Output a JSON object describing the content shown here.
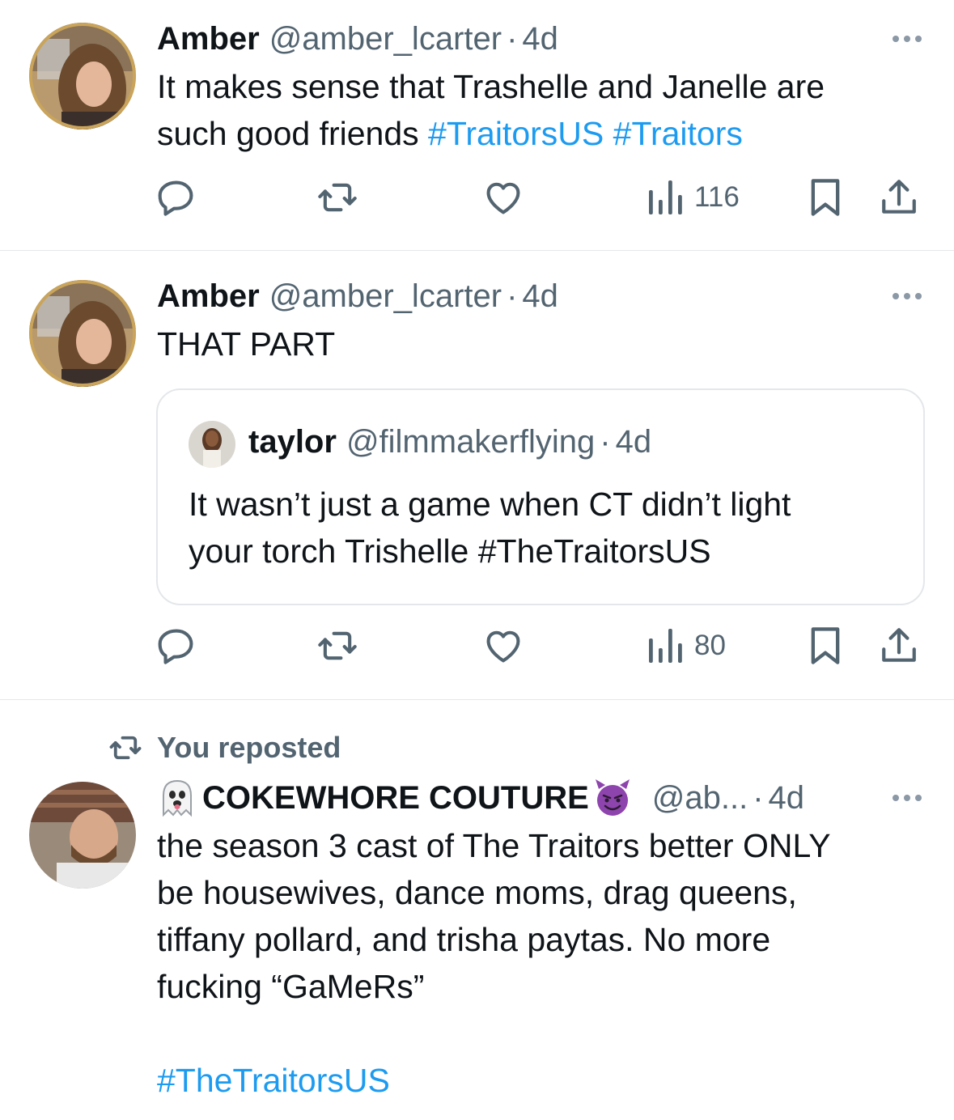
{
  "tweets": [
    {
      "name": "Amber",
      "handle": "@amber_lcarter",
      "dot": "·",
      "time": "4d",
      "text_plain": "It makes sense that Trashelle and Janelle are\nsuch good friends ",
      "hashtags": [
        "#TraitorsUS",
        "#Traitors"
      ],
      "views": "116"
    },
    {
      "name": "Amber",
      "handle": "@amber_lcarter",
      "dot": "·",
      "time": "4d",
      "text_plain": "THAT PART",
      "views": "80",
      "quote": {
        "name": "taylor",
        "handle": "@filmmakerflying",
        "dot": "·",
        "time": "4d",
        "text_plain": "It wasn’t just a game when CT didn’t light\nyour torch Trishelle ",
        "hashtag": "#TheTraitorsUS"
      }
    },
    {
      "repost_label": "You reposted",
      "name": "COKEWHORE COUTURE",
      "handle": "@ab...",
      "dot": "·",
      "time": "4d",
      "text_plain": "the season 3 cast of The Traitors better ONLY\nbe housewives, dance moms, drag queens,\ntiffany pollard, and trisha paytas. No more\nfucking “GaMeRs”",
      "hashtag": "#TheTraitorsUS"
    }
  ],
  "icons": {
    "reply": "reply-icon",
    "repost": "repost-icon",
    "like": "like-icon",
    "views": "views-icon",
    "bookmark": "bookmark-icon",
    "share": "share-icon",
    "more": "more-icon"
  },
  "colors": {
    "text": "#0f1419",
    "secondary": "#536471",
    "link": "#1d9bf0",
    "divider": "#e4e7ea"
  }
}
